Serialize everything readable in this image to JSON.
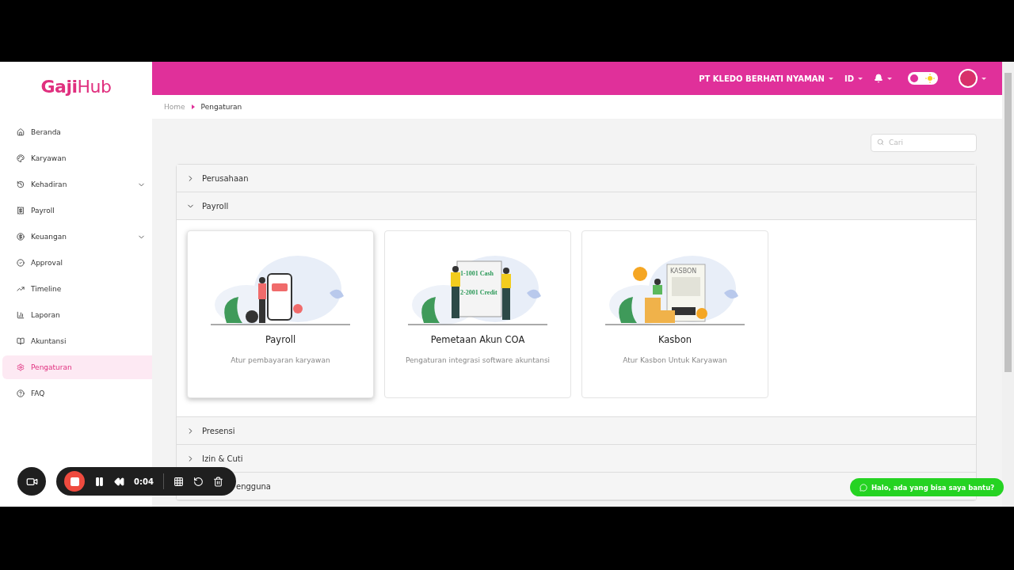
{
  "sidebar": {
    "logo": {
      "first": "Gaji",
      "second": "Hub"
    },
    "items": [
      {
        "label": "Beranda",
        "expandable": false,
        "selected": false
      },
      {
        "label": "Karyawan",
        "expandable": false,
        "selected": false
      },
      {
        "label": "Kehadiran",
        "expandable": true,
        "selected": false
      },
      {
        "label": "Payroll",
        "expandable": false,
        "selected": false
      },
      {
        "label": "Keuangan",
        "expandable": true,
        "selected": false
      },
      {
        "label": "Approval",
        "expandable": false,
        "selected": false
      },
      {
        "label": "Timeline",
        "expandable": false,
        "selected": false
      },
      {
        "label": "Laporan",
        "expandable": false,
        "selected": false
      },
      {
        "label": "Akuntansi",
        "expandable": false,
        "selected": false
      },
      {
        "label": "Pengaturan",
        "expandable": false,
        "selected": true
      },
      {
        "label": "FAQ",
        "expandable": false,
        "selected": false
      }
    ]
  },
  "header": {
    "company": "PT KLEDO BERHATI NYAMAN",
    "language": "ID",
    "dark_mode": false
  },
  "breadcrumb": [
    {
      "label": "Home",
      "selected": false
    },
    {
      "label": "Pengaturan",
      "selected": true
    }
  ],
  "search": {
    "placeholder": "Cari"
  },
  "sections": [
    {
      "label": "Perusahaan",
      "kind": "section",
      "expanded": false
    },
    {
      "label": "Payroll",
      "kind": "section",
      "expanded": true,
      "cards": [
        {
          "title": "Payroll",
          "description": "Atur pembayaran karyawan",
          "hovered": true
        },
        {
          "title": "Pemetaan Akun COA",
          "description": "Pengaturan integrasi software akuntansi",
          "hovered": false,
          "art_labels": [
            "1-1001 Cash",
            "2-2001 Credit"
          ]
        },
        {
          "title": "Kasbon",
          "description": "Atur Kasbon Untuk Karyawan",
          "hovered": false,
          "art_labels": [
            "KASBON"
          ]
        }
      ]
    },
    {
      "label": "Presensi",
      "kind": "section",
      "expanded": false
    },
    {
      "label": "Izin & Cuti",
      "kind": "section",
      "expanded": false
    },
    {
      "label": "engguna",
      "kind": "covered",
      "expanded": false
    }
  ],
  "recorder": {
    "time": "0:04",
    "recording": true
  },
  "chat": {
    "label": "Halo, ada yang bisa saya bantu?"
  }
}
